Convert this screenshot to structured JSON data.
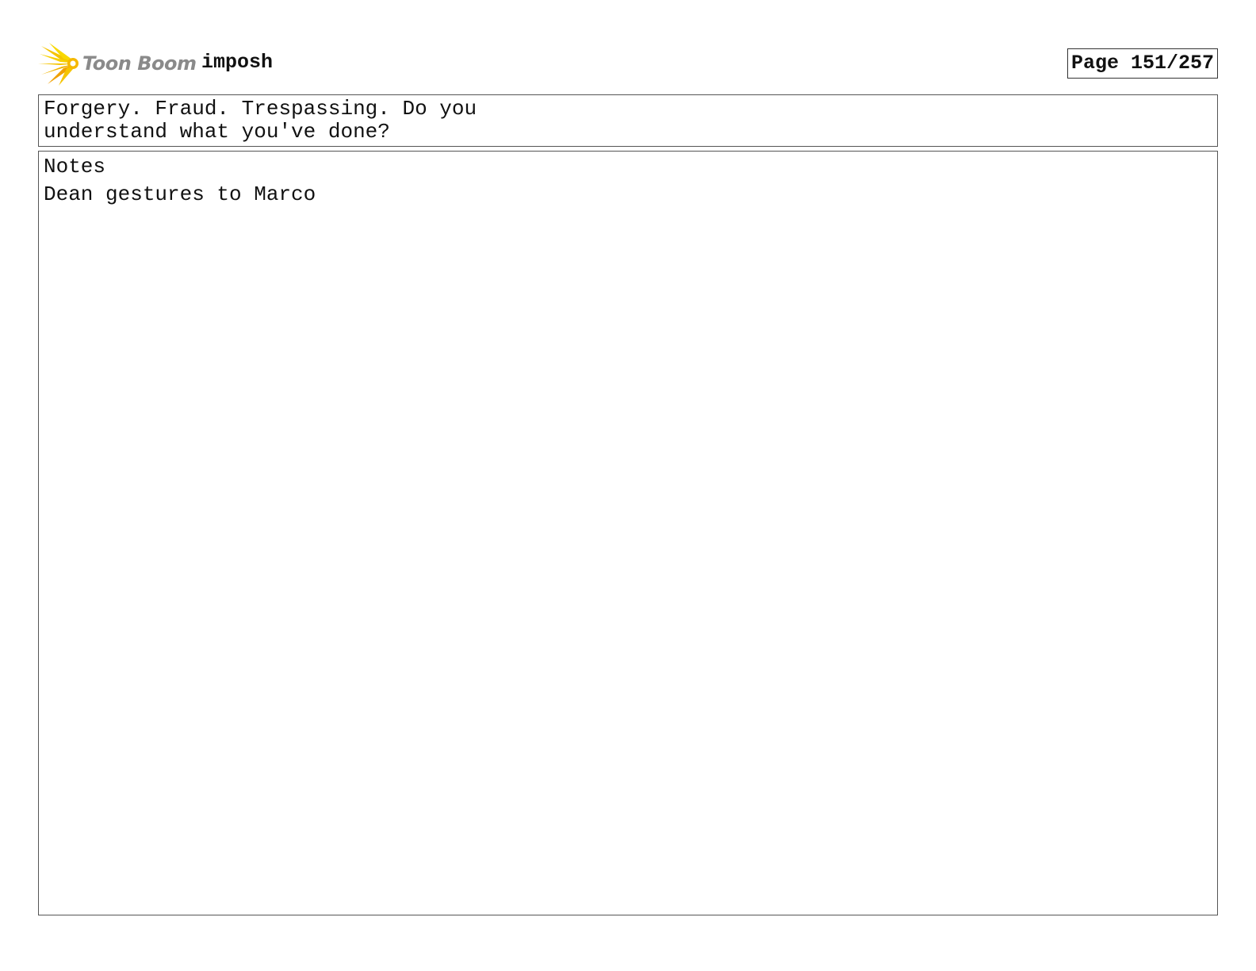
{
  "header": {
    "logo_text": "Toon Boom",
    "project_title": "imposh",
    "page_label": "Page 151/257"
  },
  "dialogue": {
    "text": "Forgery. Fraud. Trespassing. Do you\nunderstand what you've done?"
  },
  "notes": {
    "label": "Notes",
    "text": "Dean gestures to Marco"
  },
  "colors": {
    "logo_yellow": "#f5c400",
    "logo_orange": "#f0a000",
    "logo_text_gray": "#8a8a8a"
  }
}
